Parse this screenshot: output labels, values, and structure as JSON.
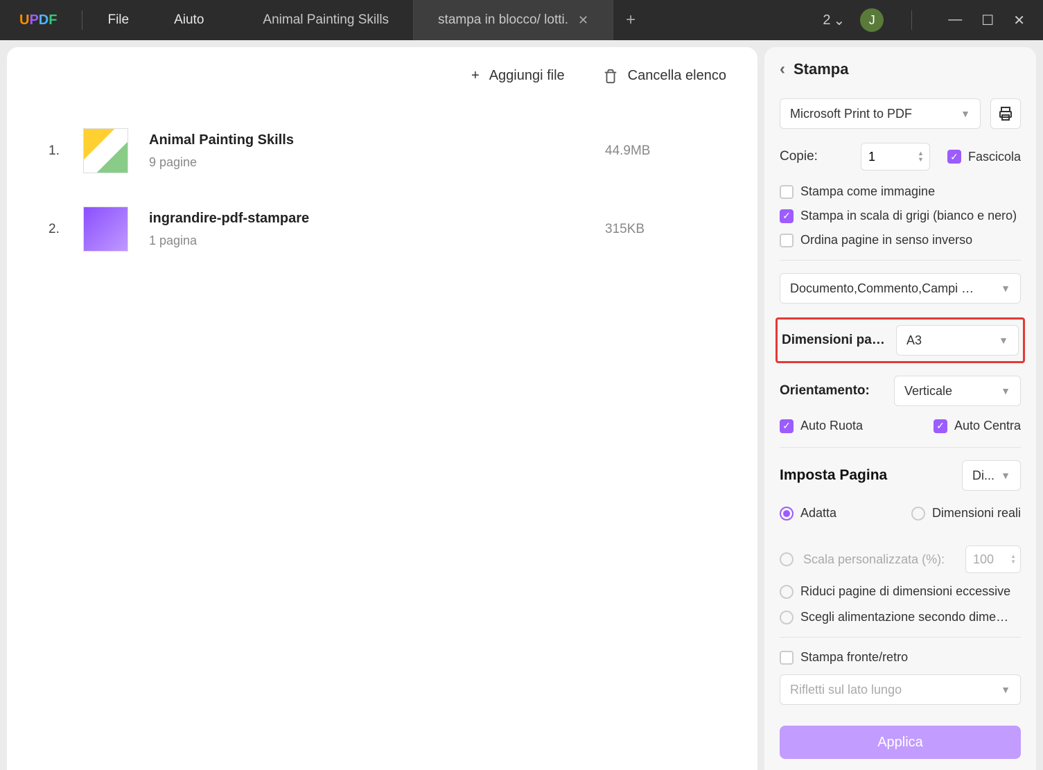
{
  "titlebar": {
    "logo_text": "UPDF",
    "menu": {
      "file": "File",
      "help": "Aiuto"
    },
    "tabs": [
      {
        "label": "Animal Painting Skills",
        "active": false
      },
      {
        "label": "stampa in blocco/ lotti.",
        "active": true
      }
    ],
    "count": "2",
    "avatar": "J"
  },
  "file_panel": {
    "add_label": "Aggiungi file",
    "clear_label": "Cancella elenco",
    "files": [
      {
        "index": "1.",
        "title": "Animal Painting Skills",
        "pages": "9 pagine",
        "size": "44.9MB"
      },
      {
        "index": "2.",
        "title": "ingrandire-pdf-stampare",
        "pages": "1 pagina",
        "size": "315KB"
      }
    ]
  },
  "print_panel": {
    "title": "Stampa",
    "printer": "Microsoft Print to PDF",
    "copies_label": "Copie:",
    "copies_value": "1",
    "collate_label": "Fascicola",
    "print_as_image_label": "Stampa come immagine",
    "grayscale_label": "Stampa in scala di grigi (bianco e nero)",
    "reverse_label": "Ordina pagine in senso inverso",
    "content_select": "Documento,Commento,Campi mo...",
    "page_size_label": "Dimensioni pag...",
    "page_size_value": "A3",
    "orientation_label": "Orientamento:",
    "orientation_value": "Verticale",
    "auto_rotate_label": "Auto Ruota",
    "auto_center_label": "Auto Centra",
    "page_setup_label": "Imposta Pagina",
    "page_setup_select": "Di...",
    "fit_label": "Adatta",
    "actual_size_label": "Dimensioni reali",
    "custom_scale_label": "Scala personalizzata (%):",
    "custom_scale_value": "100",
    "shrink_label": "Riduci pagine di dimensioni eccessive",
    "choose_paper_label": "Scegli alimentazione secondo dimensi...",
    "duplex_label": "Stampa fronte/retro",
    "flip_label": "Rifletti sul lato lungo",
    "apply_label": "Applica"
  }
}
